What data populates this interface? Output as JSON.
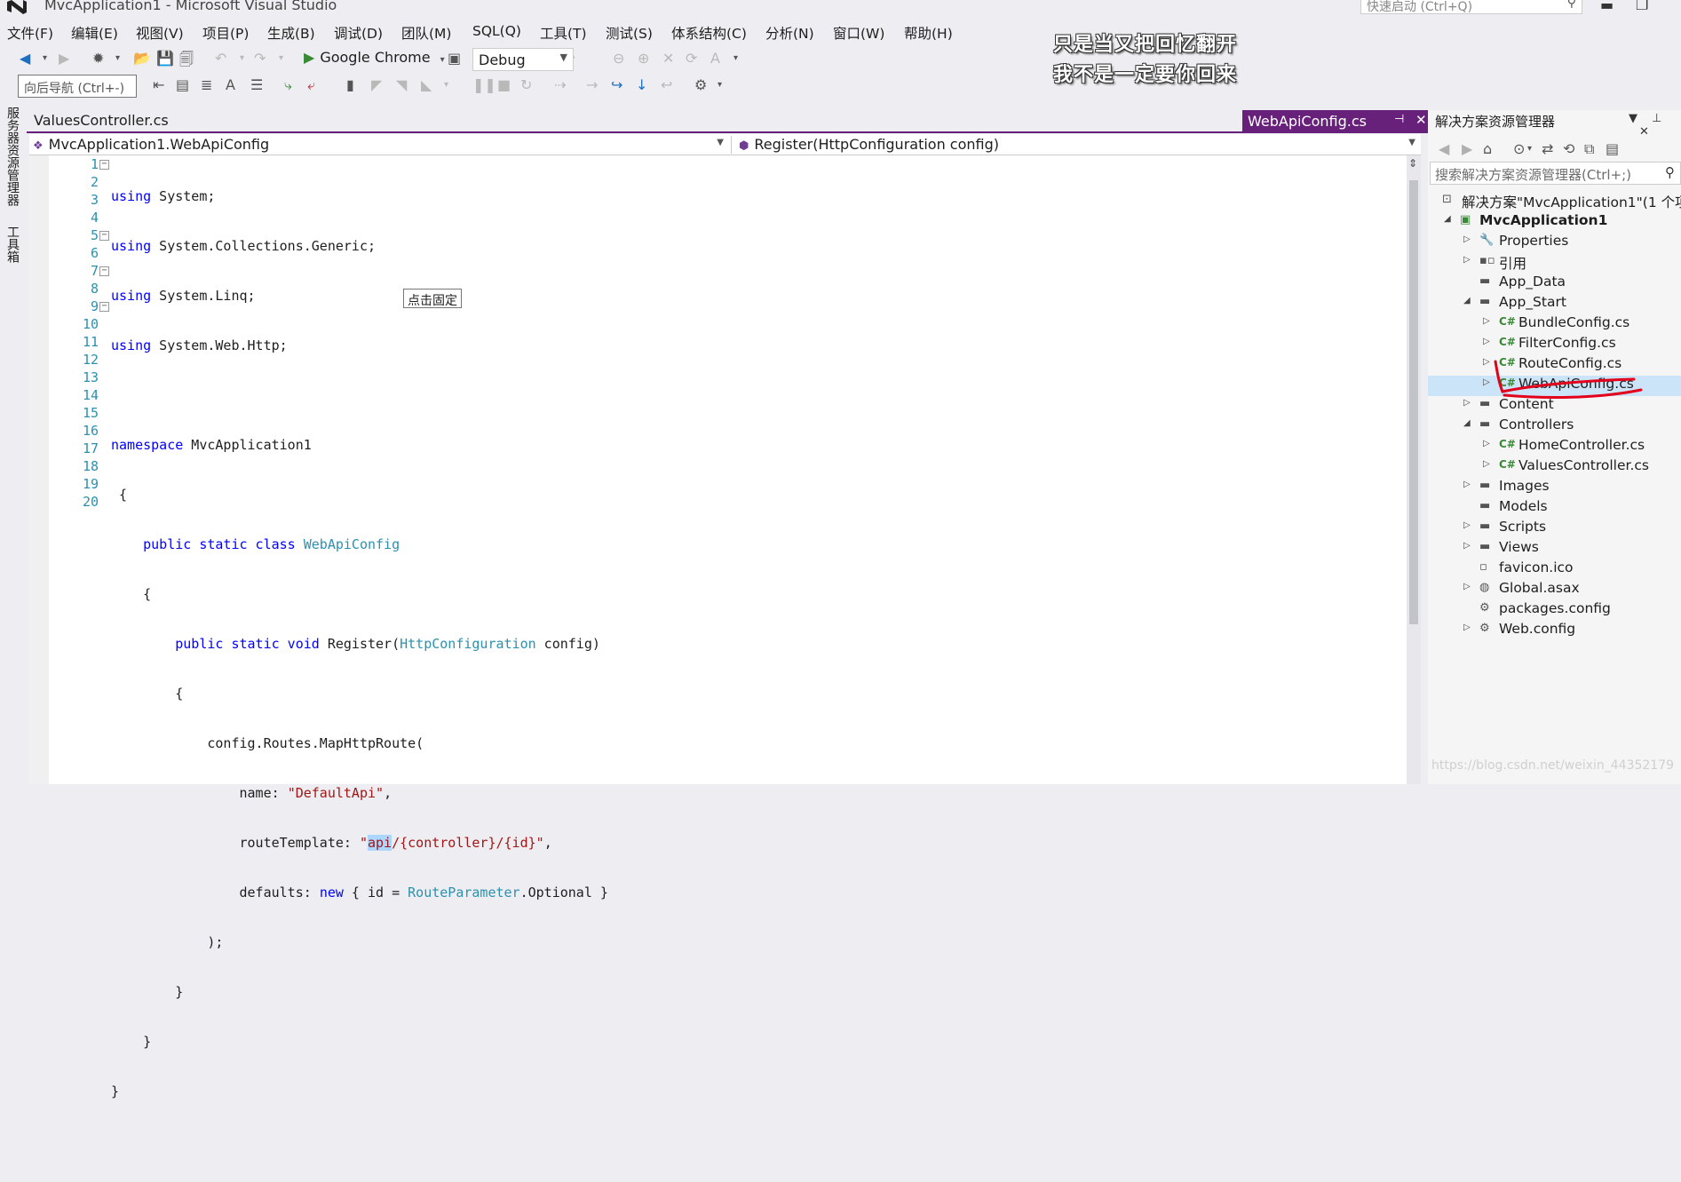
{
  "window": {
    "title": "MvcApplication1 - Microsoft Visual Studio",
    "quick_launch_placeholder": "快速启动 (Ctrl+Q)"
  },
  "menu": [
    "文件(F)",
    "编辑(E)",
    "视图(V)",
    "项目(P)",
    "生成(B)",
    "调试(D)",
    "团队(M)",
    "SQL(Q)",
    "工具(T)",
    "测试(S)",
    "体系结构(C)",
    "分析(N)",
    "窗口(W)",
    "帮助(H)"
  ],
  "toolbar": {
    "browser": "Google Chrome",
    "configuration": "Debug",
    "nav_back_tooltip": "向后导航 (Ctrl+-)"
  },
  "lyrics": [
    "只是当又把回忆翻开",
    "我不是一定要你回来"
  ],
  "left_strip": [
    "服务器资源管理器",
    "工具箱"
  ],
  "tabs": {
    "inactive": "ValuesController.cs",
    "active": "WebApiConfig.cs"
  },
  "navbar": {
    "type": "MvcApplication1.WebApiConfig",
    "member": "Register(HttpConfiguration config)"
  },
  "editor": {
    "line_numbers": [
      "1",
      "2",
      "3",
      "4",
      "5",
      "6",
      "7",
      "8",
      "9",
      "10",
      "11",
      "12",
      "13",
      "14",
      "15",
      "16",
      "17",
      "18",
      "19",
      "20"
    ],
    "pin_tooltip": "点击固定",
    "code": {
      "l1_kw": "using",
      "l1_rest": " System;",
      "l2_kw": "using",
      "l2_rest": " System.Collections.Generic;",
      "l3_kw": "using",
      "l3_rest": " System.Linq;",
      "l4_kw": "using",
      "l4_rest": " System.Web.Http;",
      "l6_kw": "namespace",
      "l6_rest": " MvcApplication1",
      "l7": " {",
      "l8_indent": "    ",
      "l8_kw": "public static class",
      "l8_type": "WebApiConfig",
      "l9": "    {",
      "l10_indent": "        ",
      "l10_kw": "public static void",
      "l10_name": " Register(",
      "l10_type": "HttpConfiguration",
      "l10_rest": " config)",
      "l11": "        {",
      "l12": "            config.Routes.MapHttpRoute(",
      "l13_pre": "                name: ",
      "l13_str": "\"DefaultApi\"",
      "l13_post": ",",
      "l14_pre": "                routeTemplate: ",
      "l14_q": "\"",
      "l14_sel": "api",
      "l14_str": "/{controller}/{id}\"",
      "l14_post": ",",
      "l15_pre": "                defaults: ",
      "l15_kw": "new",
      "l15_mid": " { id = ",
      "l15_type": "RouteParameter",
      "l15_post": ".Optional }",
      "l16": "            );",
      "l17": "        }",
      "l18": "    }",
      "l19": "}"
    }
  },
  "solution_explorer": {
    "title": "解决方案资源管理器",
    "search_placeholder": "搜索解决方案资源管理器(Ctrl+;)",
    "solution": "解决方案\"MvcApplication1\"(1 个项",
    "project": "MvcApplication1",
    "items": {
      "properties": "Properties",
      "references": "引用",
      "app_data": "App_Data",
      "app_start": "App_Start",
      "bundle": "BundleConfig.cs",
      "filter": "FilterConfig.cs",
      "route": "RouteConfig.cs",
      "webapi": "WebApiConfig.cs",
      "content": "Content",
      "controllers": "Controllers",
      "home": "HomeController.cs",
      "values": "ValuesController.cs",
      "images": "Images",
      "models": "Models",
      "scripts": "Scripts",
      "views": "Views",
      "favicon": "favicon.ico",
      "global": "Global.asax",
      "packages": "packages.config",
      "webconfig": "Web.config"
    }
  },
  "watermark": "https://blog.csdn.net/weixin_44352179",
  "colors": {
    "accent": "#68217a",
    "keyword": "#0000ff",
    "type": "#2b91af",
    "string": "#a31515",
    "selection": "#cce4f7",
    "annotation": "#e3001b"
  }
}
